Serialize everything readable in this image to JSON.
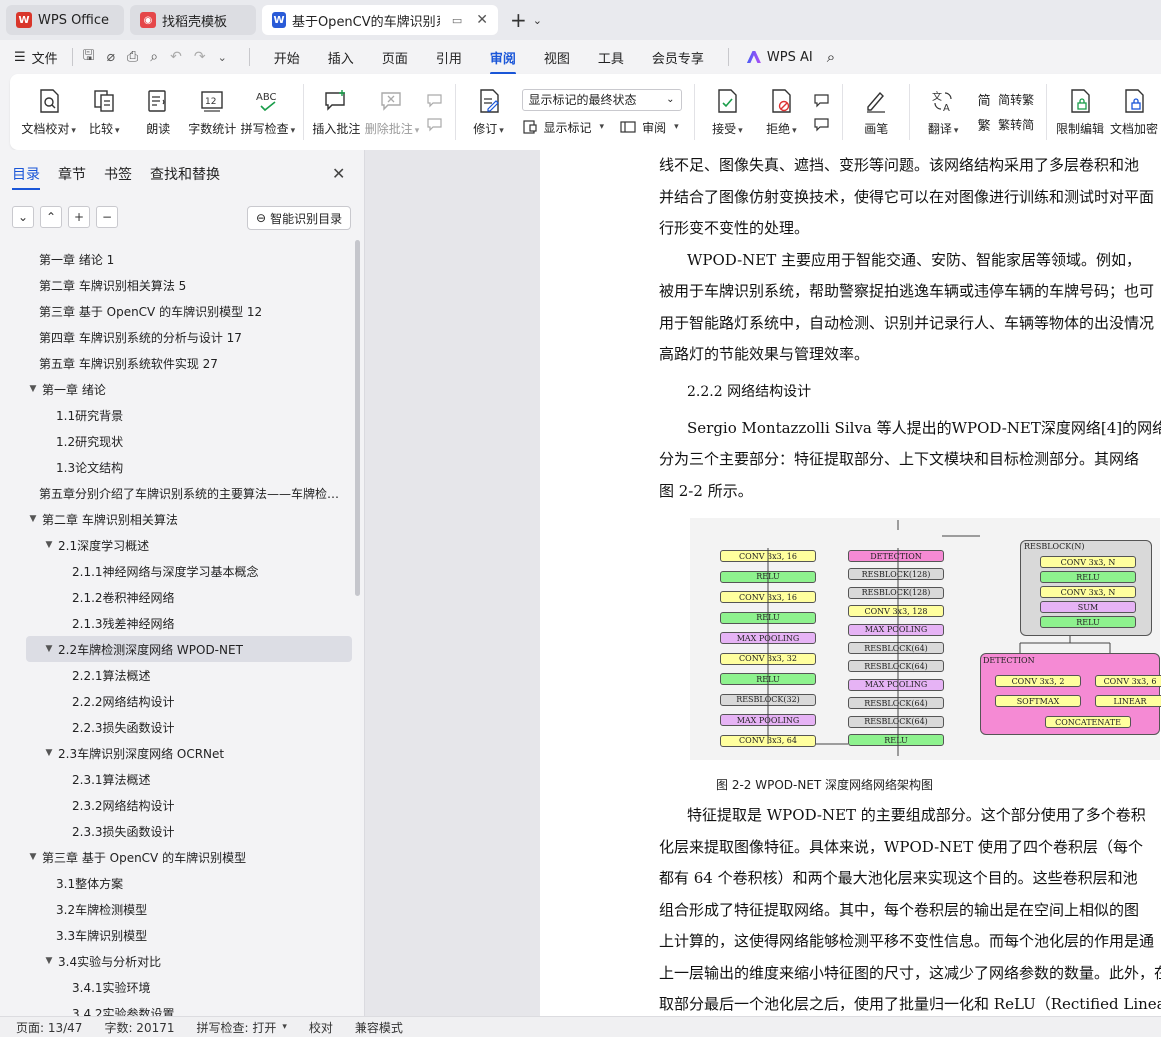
{
  "tabs": [
    {
      "label": "WPS Office",
      "icon": "wps-logo-icon",
      "color": "#d9362b"
    },
    {
      "label": "找稻壳模板",
      "icon": "docer-icon",
      "color": "#e5474a"
    },
    {
      "label": "基于OpenCV的车牌识别系统",
      "icon": "wps-writer-icon",
      "color": "#2a5bd7"
    }
  ],
  "menu": {
    "file": "文件",
    "tabs": [
      "开始",
      "插入",
      "页面",
      "引用",
      "审阅",
      "视图",
      "工具",
      "会员专享"
    ],
    "active_tab": "审阅",
    "ai": "WPS AI"
  },
  "ribbon": {
    "doc_proof": "文档校对",
    "compare": "比较",
    "read_aloud": "朗读",
    "word_count": "字数统计",
    "spell_check": "拼写检查",
    "insert_comment": "插入批注",
    "delete_comment": "删除批注",
    "revise": "修订",
    "markup_select": "显示标记的最终状态",
    "show_markup": "显示标记",
    "review": "审阅",
    "accept": "接受",
    "reject": "拒绝",
    "ink": "画笔",
    "translate": "翻译",
    "trad": "简转繁",
    "simp": "繁转简",
    "restrict": "限制编辑",
    "encrypt": "文档加密"
  },
  "left_panel": {
    "tabs": [
      "目录",
      "章节",
      "书签",
      "查找和替换"
    ],
    "active_tab": "目录",
    "smart_toc": "智能识别目录",
    "toc": [
      {
        "level": 0,
        "text": "第一章 绪论 1",
        "toggle": ""
      },
      {
        "level": 0,
        "text": "第二章 车牌识别相关算法 5",
        "toggle": ""
      },
      {
        "level": 0,
        "text": "第三章 基于 OpenCV 的车牌识别模型 12",
        "toggle": ""
      },
      {
        "level": 0,
        "text": "第四章 车牌识别系统的分析与设计 17",
        "toggle": ""
      },
      {
        "level": 0,
        "text": "第五章 车牌识别系统软件实现 27",
        "toggle": ""
      },
      {
        "level": 0,
        "text": "第一章 绪论",
        "toggle": "▼"
      },
      {
        "level": 1,
        "text": "1.1研究背景",
        "toggle": ""
      },
      {
        "level": 1,
        "text": "1.2研究现状",
        "toggle": ""
      },
      {
        "level": 1,
        "text": "1.3论文结构",
        "toggle": ""
      },
      {
        "level": 0,
        "text": "第五章分别介绍了车牌识别系统的主要算法——车牌检…",
        "toggle": ""
      },
      {
        "level": 0,
        "text": "第二章 车牌识别相关算法",
        "toggle": "▼"
      },
      {
        "level": 1,
        "text": "2.1深度学习概述",
        "toggle": "▼"
      },
      {
        "level": 2,
        "text": "2.1.1神经网络与深度学习基本概念",
        "toggle": ""
      },
      {
        "level": 2,
        "text": "2.1.2卷积神经网络",
        "toggle": ""
      },
      {
        "level": 2,
        "text": "2.1.3残差神经网络",
        "toggle": ""
      },
      {
        "level": 1,
        "text": "2.2车牌检测深度网络 WPOD-NET",
        "toggle": "▼",
        "selected": true
      },
      {
        "level": 2,
        "text": "2.2.1算法概述",
        "toggle": ""
      },
      {
        "level": 2,
        "text": "2.2.2网络结构设计",
        "toggle": ""
      },
      {
        "level": 2,
        "text": "2.2.3损失函数设计",
        "toggle": ""
      },
      {
        "level": 1,
        "text": "2.3车牌识别深度网络 OCRNet",
        "toggle": "▼"
      },
      {
        "level": 2,
        "text": "2.3.1算法概述",
        "toggle": ""
      },
      {
        "level": 2,
        "text": "2.3.2网络结构设计",
        "toggle": ""
      },
      {
        "level": 2,
        "text": "2.3.3损失函数设计",
        "toggle": ""
      },
      {
        "level": 0,
        "text": "第三章 基于 OpenCV 的车牌识别模型",
        "toggle": "▼"
      },
      {
        "level": 1,
        "text": "3.1整体方案",
        "toggle": ""
      },
      {
        "level": 1,
        "text": "3.2车牌检测模型",
        "toggle": ""
      },
      {
        "level": 1,
        "text": "3.3车牌识别模型",
        "toggle": ""
      },
      {
        "level": 1,
        "text": "3.4实验与分析对比",
        "toggle": "▼"
      },
      {
        "level": 2,
        "text": "3.4.1实验环境",
        "toggle": ""
      },
      {
        "level": 2,
        "text": "3.4.2实验参数设置",
        "toggle": ""
      }
    ]
  },
  "document": {
    "lines_top": [
      {
        "text": "线不足、图像失真、遮挡、变形等问题。该网络结构采用了多层卷积和池",
        "indent": false
      },
      {
        "text": "并结合了图像仿射变换技术，使得它可以在对图像进行训练和测试时对平面",
        "indent": false
      },
      {
        "text": "行形变不变性的处理。",
        "indent": false
      },
      {
        "text": "WPOD-NET 主要应用于智能交通、安防、智能家居等领域。例如，",
        "indent": true
      },
      {
        "text": "被用于车牌识别系统，帮助警察捉拍逃逸车辆或违停车辆的车牌号码；也可",
        "indent": false
      },
      {
        "text": "用于智能路灯系统中，自动检测、识别并记录行人、车辆等物体的出没情况",
        "indent": false
      },
      {
        "text": "高路灯的节能效果与管理效率。",
        "indent": false
      },
      {
        "text": "2.2.2 网络结构设计",
        "indent": true
      },
      {
        "text": "Sergio  Montazzolli  Silva 等人提出的WPOD-NET深度网络[4]的网络结",
        "indent": true
      },
      {
        "text": "分为三个主要部分：特征提取部分、上下文模块和目标检测部分。其网络",
        "indent": false
      },
      {
        "text": "图 2-2 所示。",
        "indent": false
      }
    ],
    "caption": "图  2-2 WPOD-NET 深度网络网络架构图",
    "lines_bottom": [
      {
        "text": "特征提取是  WPOD-NET 的主要组成部分。这个部分使用了多个卷积",
        "indent": true
      },
      {
        "text": "化层来提取图像特征。具体来说，WPOD-NET 使用了四个卷积层（每个",
        "indent": false
      },
      {
        "text": "都有 64 个卷积核）和两个最大池化层来实现这个目的。这些卷积层和池",
        "indent": false
      },
      {
        "text": "组合形成了特征提取网络。其中，每个卷积层的输出是在空间上相似的图",
        "indent": false
      },
      {
        "text": "上计算的，这使得网络能够检测平移不变性信息。而每个池化层的作用是通",
        "indent": false
      },
      {
        "text": "上一层输出的维度来缩小特征图的尺寸，这减少了网络参数的数量。此外，在",
        "indent": false
      },
      {
        "text": "取部分最后一个池化层之后，使用了批量归一化和  ReLU（Rectified Linear U",
        "indent": false
      }
    ],
    "figure": {
      "col1": [
        "CONV 3x3, 16",
        "RELU",
        "CONV 3x3, 16",
        "RELU",
        "MAX POOLING",
        "CONV 3x3, 32",
        "RELU",
        "RESBLOCK(32)",
        "MAX POOLING",
        "CONV 3x3, 64"
      ],
      "col2": [
        "DETECTION",
        "RESBLOCK(128)",
        "RESBLOCK(128)",
        "CONV 3x3, 128",
        "MAX POOLING",
        "RESBLOCK(64)",
        "RESBLOCK(64)",
        "MAX POOLING",
        "RESBLOCK(64)",
        "RESBLOCK(64)",
        "RELU"
      ],
      "resblock_title": "RESBLOCK(N)",
      "resblock": [
        "CONV 3x3, N",
        "RELU",
        "CONV 3x3, N",
        "SUM",
        "RELU"
      ],
      "detection_title": "DETECTION",
      "detection": [
        "CONV 3x3, 2",
        "CONV 3x3, 6",
        "SOFTMAX",
        "LINEAR",
        "CONCATENATE"
      ]
    }
  },
  "status": {
    "page": "页面: 13/47",
    "words": "字数: 20171",
    "spell": "拼写检查: 打开",
    "proof": "校对",
    "compat": "兼容模式"
  }
}
